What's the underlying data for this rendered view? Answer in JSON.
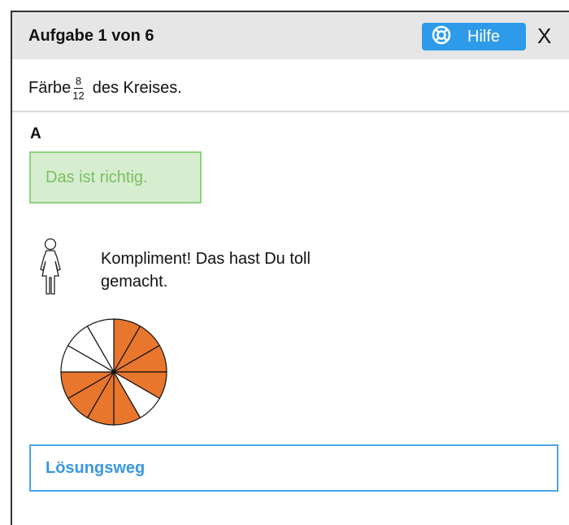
{
  "header": {
    "title": "Aufgabe 1 von 6",
    "help_label": "Hilfe",
    "close_label": "X"
  },
  "task": {
    "prefix": "Färbe",
    "fraction_numerator": "8",
    "fraction_denominator": "12",
    "suffix": "des Kreises."
  },
  "answer": {
    "part_label": "A",
    "feedback_text": "Das ist richtig.",
    "praise_text": "Kompliment!  Das hast Du toll gemacht."
  },
  "circle": {
    "total_slices": 12,
    "colored_slices": [
      0,
      1,
      2,
      3,
      5,
      6,
      7,
      8
    ],
    "fill_color": "#e8762d",
    "empty_color": "#ffffff"
  },
  "solution": {
    "label": "Lösungsweg"
  },
  "colors": {
    "accent_blue": "#2d9be9",
    "success_green": "#7bbf62",
    "success_bg": "#d7edd0"
  },
  "icons": {
    "help": "lifebuoy-icon",
    "tutor": "person-icon"
  }
}
